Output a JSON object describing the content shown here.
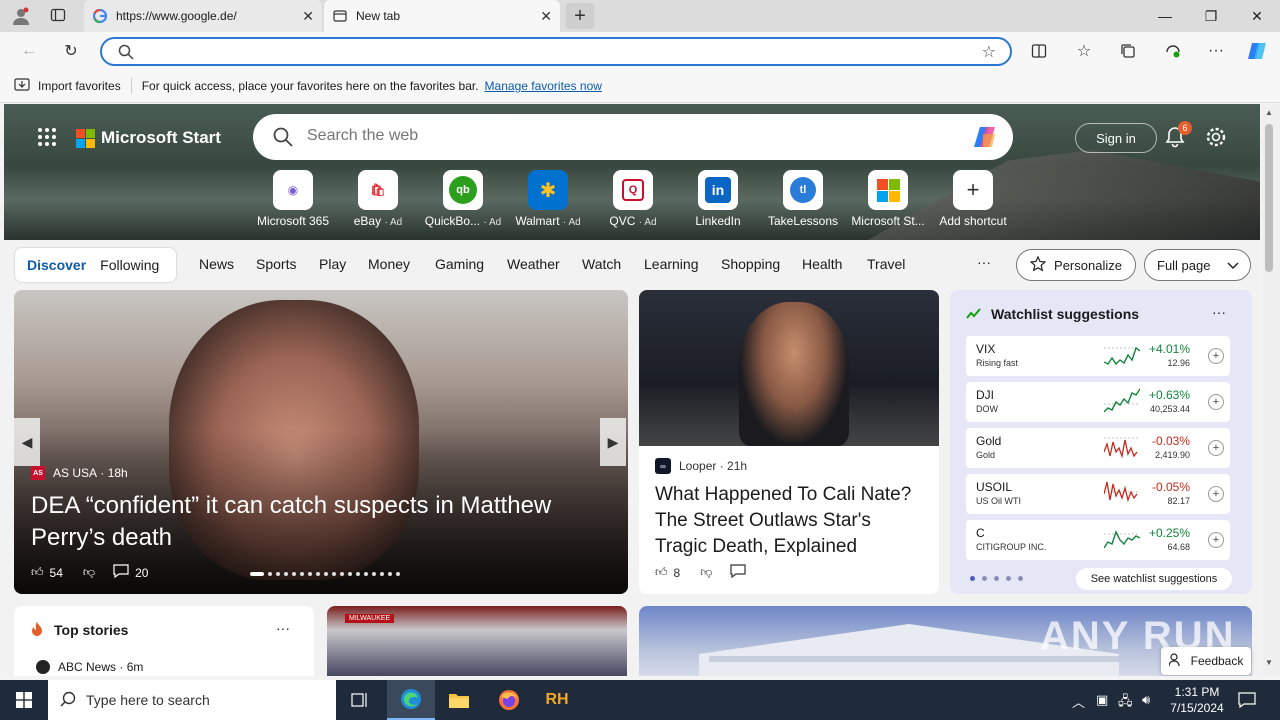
{
  "browser": {
    "tabs": [
      {
        "label": "https://www.google.de/",
        "icon": "google-icon"
      },
      {
        "label": "New tab",
        "icon": "newtab-icon"
      }
    ],
    "address": {
      "value": "",
      "placeholder": ""
    },
    "favorites_bar": {
      "import_label": "Import favorites",
      "message": "For quick access, place your favorites here on the favorites bar.",
      "link": "Manage favorites now"
    }
  },
  "msn": {
    "brand": "Microsoft Start",
    "search_placeholder": "Search the web",
    "signin": "Sign in",
    "notification_count": "6",
    "shortcuts": [
      {
        "label": "Microsoft 365",
        "ad": "",
        "glyph": "M",
        "color": "#7a5cd6"
      },
      {
        "label": "eBay",
        "ad": "· Ad",
        "glyph": "eBay",
        "color": "#e53238"
      },
      {
        "label": "QuickBo...",
        "ad": "· Ad",
        "glyph": "qb",
        "color": "#2ca01c"
      },
      {
        "label": "Walmart",
        "ad": "· Ad",
        "glyph": "✱",
        "color": "#0071ce"
      },
      {
        "label": "QVC",
        "ad": "· Ad",
        "glyph": "Q",
        "color": "#c8102e"
      },
      {
        "label": "LinkedIn",
        "ad": "",
        "glyph": "in",
        "color": "#0a66c2"
      },
      {
        "label": "TakeLessons",
        "ad": "",
        "glyph": "tl",
        "color": "#2b7bd8"
      },
      {
        "label": "Microsoft St...",
        "ad": "",
        "glyph": "",
        "color": "#f25022"
      },
      {
        "label": "Add shortcut",
        "ad": "",
        "glyph": "+",
        "color": "#333333"
      }
    ],
    "nav": {
      "discover": "Discover",
      "following": "Following",
      "items": [
        "News",
        "Sports",
        "Play",
        "Money",
        "Gaming",
        "Weather",
        "Watch",
        "Learning",
        "Shopping",
        "Health",
        "Travel"
      ],
      "more": "···",
      "personalize": "Personalize",
      "fullpage": "Full page"
    },
    "main_story": {
      "source": "AS USA",
      "age": "· 18h",
      "headline": "DEA “confident” it can catch suspects in Matthew Perry’s death",
      "likes": "54",
      "comments": "20"
    },
    "story2": {
      "source": "Looper",
      "age": "· 21h",
      "headline": "What Happened To Cali Nate? The Street Outlaws Star's Tragic Death, Explained",
      "likes": "8"
    },
    "watchlist": {
      "title": "Watchlist suggestions",
      "more": "···",
      "see_all": "See watchlist suggestions",
      "stocks": [
        {
          "symbol": "VIX",
          "sub": "Rising fast",
          "change": "+4.01%",
          "price": "12.96",
          "dir": "up"
        },
        {
          "symbol": "DJI",
          "sub": "DOW",
          "change": "+0.63%",
          "price": "40,253.44",
          "dir": "up"
        },
        {
          "symbol": "Gold",
          "sub": "Gold",
          "change": "-0.03%",
          "price": "2,419.90",
          "dir": "down"
        },
        {
          "symbol": "USOIL",
          "sub": "US Oil WTI",
          "change": "-0.05%",
          "price": "82.17",
          "dir": "down"
        },
        {
          "symbol": "C",
          "sub": "CITIGROUP INC.",
          "change": "+0.25%",
          "price": "64.68",
          "dir": "up"
        }
      ]
    },
    "top_stories": {
      "title": "Top stories",
      "more": "···",
      "source": "ABC News",
      "age": "· 6m"
    },
    "card4_banner": "MILWAUKEE",
    "feedback": "Feedback",
    "watermark": "ANY RUN"
  },
  "taskbar": {
    "search_placeholder": "Type here to search",
    "time": "1:31 PM",
    "date": "7/15/2024"
  }
}
